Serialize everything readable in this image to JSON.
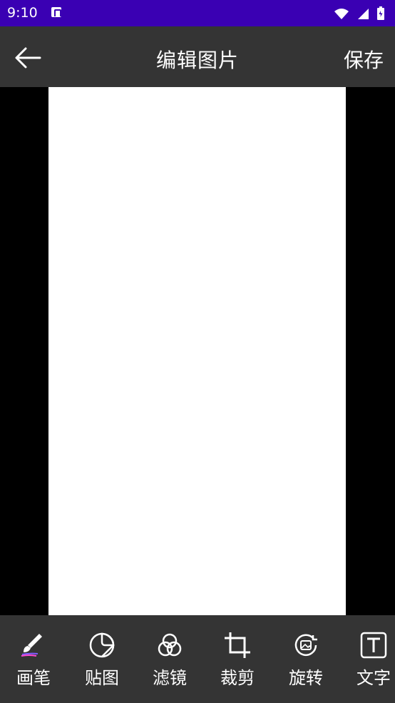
{
  "status": {
    "time": "9:10"
  },
  "appbar": {
    "title": "编辑图片",
    "save_label": "保存"
  },
  "tools": [
    {
      "label": "画笔",
      "icon": "brush-icon"
    },
    {
      "label": "贴图",
      "icon": "sticker-icon"
    },
    {
      "label": "滤镜",
      "icon": "filter-icon"
    },
    {
      "label": "裁剪",
      "icon": "crop-icon"
    },
    {
      "label": "旋转",
      "icon": "rotate-icon"
    },
    {
      "label": "文字",
      "icon": "text-icon"
    }
  ],
  "colors": {
    "status_bar": "#3a00b3",
    "toolbar": "#343434",
    "canvas_bg": "#000000",
    "image_bg": "#ffffff"
  }
}
